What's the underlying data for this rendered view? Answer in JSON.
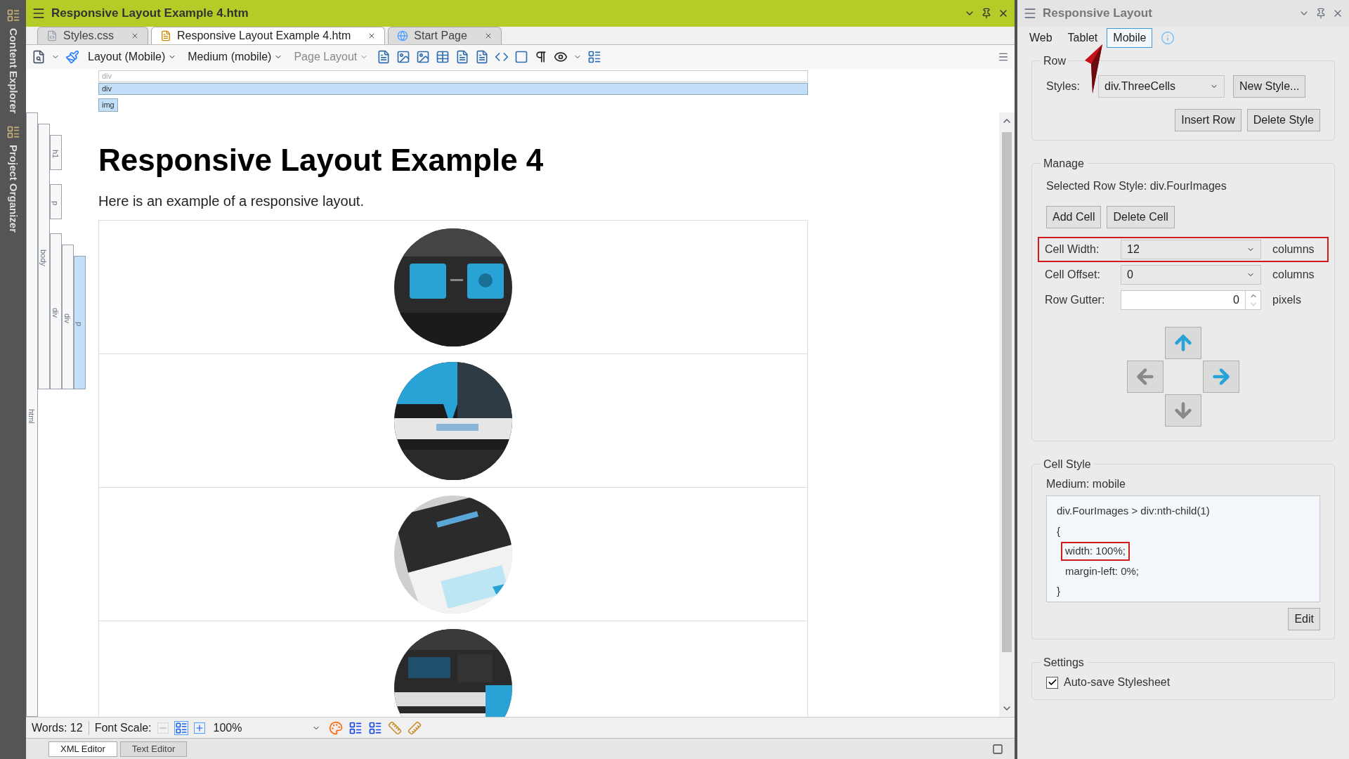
{
  "side_dock": [
    {
      "label": "Content Explorer"
    },
    {
      "label": "Project Organizer"
    }
  ],
  "editor": {
    "title": "Responsive Layout Example 4.htm",
    "tabs": [
      {
        "label": "Styles.css",
        "kind": "css",
        "selected": false
      },
      {
        "label": "Responsive Layout Example 4.htm",
        "kind": "htm",
        "selected": true
      },
      {
        "label": "Start Page",
        "kind": "page",
        "selected": false
      }
    ],
    "toolbar_dropdowns": [
      {
        "label": "Layout (Mobile)",
        "disabled": false
      },
      {
        "label": "Medium (mobile)",
        "disabled": false
      },
      {
        "label": "Page Layout",
        "disabled": true
      }
    ],
    "block_bars": [
      {
        "tag": "div",
        "selected": false
      },
      {
        "tag": "div",
        "selected": true
      }
    ],
    "element_tag": "img",
    "tag_tree": [
      {
        "tag": "html",
        "selected": false,
        "children": [
          {
            "tag": "body",
            "selected": false,
            "children": [
              {
                "tag": "h1",
                "selected": false
              },
              {
                "tag": "p",
                "selected": false
              },
              {
                "tag": "div",
                "selected": false,
                "children": [
                  {
                    "tag": "div",
                    "selected": false,
                    "children": [
                      {
                        "tag": "p",
                        "selected": true
                      }
                    ]
                  }
                ]
              }
            ]
          }
        ]
      }
    ],
    "document": {
      "heading": "Responsive Layout Example 4",
      "paragraph": "Here is an example of a responsive layout."
    },
    "status_bar": {
      "words": "Words: 12",
      "font_scale_label": "Font Scale:",
      "zoom": "100%"
    },
    "view_tabs": [
      {
        "label": "XML Editor",
        "selected": true
      },
      {
        "label": "Text Editor",
        "selected": false
      }
    ]
  },
  "panel": {
    "title": "Responsive Layout",
    "tabs": [
      {
        "label": "Web",
        "selected": false
      },
      {
        "label": "Tablet",
        "selected": false
      },
      {
        "label": "Mobile",
        "selected": true
      }
    ],
    "row": {
      "legend": "Row",
      "styles_label": "Styles:",
      "styles_value": "div.ThreeCells",
      "new_style": "New Style...",
      "insert_row": "Insert Row",
      "delete_style": "Delete Style"
    },
    "manage": {
      "legend": "Manage",
      "selected_row_style": "Selected Row Style: div.FourImages",
      "add_cell": "Add Cell",
      "delete_cell": "Delete Cell",
      "fields": [
        {
          "label": "Cell Width:",
          "value": "12",
          "unit": "columns",
          "kind": "dropdown",
          "highlighted": true
        },
        {
          "label": "Cell Offset:",
          "value": "0",
          "unit": "columns",
          "kind": "dropdown",
          "highlighted": false
        },
        {
          "label": "Row Gutter:",
          "value": "0",
          "unit": "pixels",
          "kind": "spinner",
          "highlighted": false
        }
      ],
      "nudge_buttons": [
        {
          "kind": "up",
          "disabled": false
        },
        {
          "kind": "left",
          "disabled": true
        },
        {
          "kind": "right",
          "disabled": false
        },
        {
          "kind": "down",
          "disabled": true
        }
      ]
    },
    "cell_style": {
      "legend": "Cell Style",
      "medium": "Medium: mobile",
      "lines": [
        {
          "text": "div.FourImages > div:nth-child(1)",
          "indented": false,
          "highlighted": false
        },
        {
          "text": "{",
          "indented": false,
          "highlighted": false
        },
        {
          "text": "width: 100%;",
          "indented": true,
          "highlighted": true
        },
        {
          "text": "margin-left: 0%;",
          "indented": true,
          "highlighted": false
        },
        {
          "text": "}",
          "indented": false,
          "highlighted": false
        }
      ],
      "edit": "Edit"
    },
    "settings": {
      "legend": "Settings",
      "autosave_label": "Auto-save Stylesheet",
      "autosave_checked": true
    }
  }
}
